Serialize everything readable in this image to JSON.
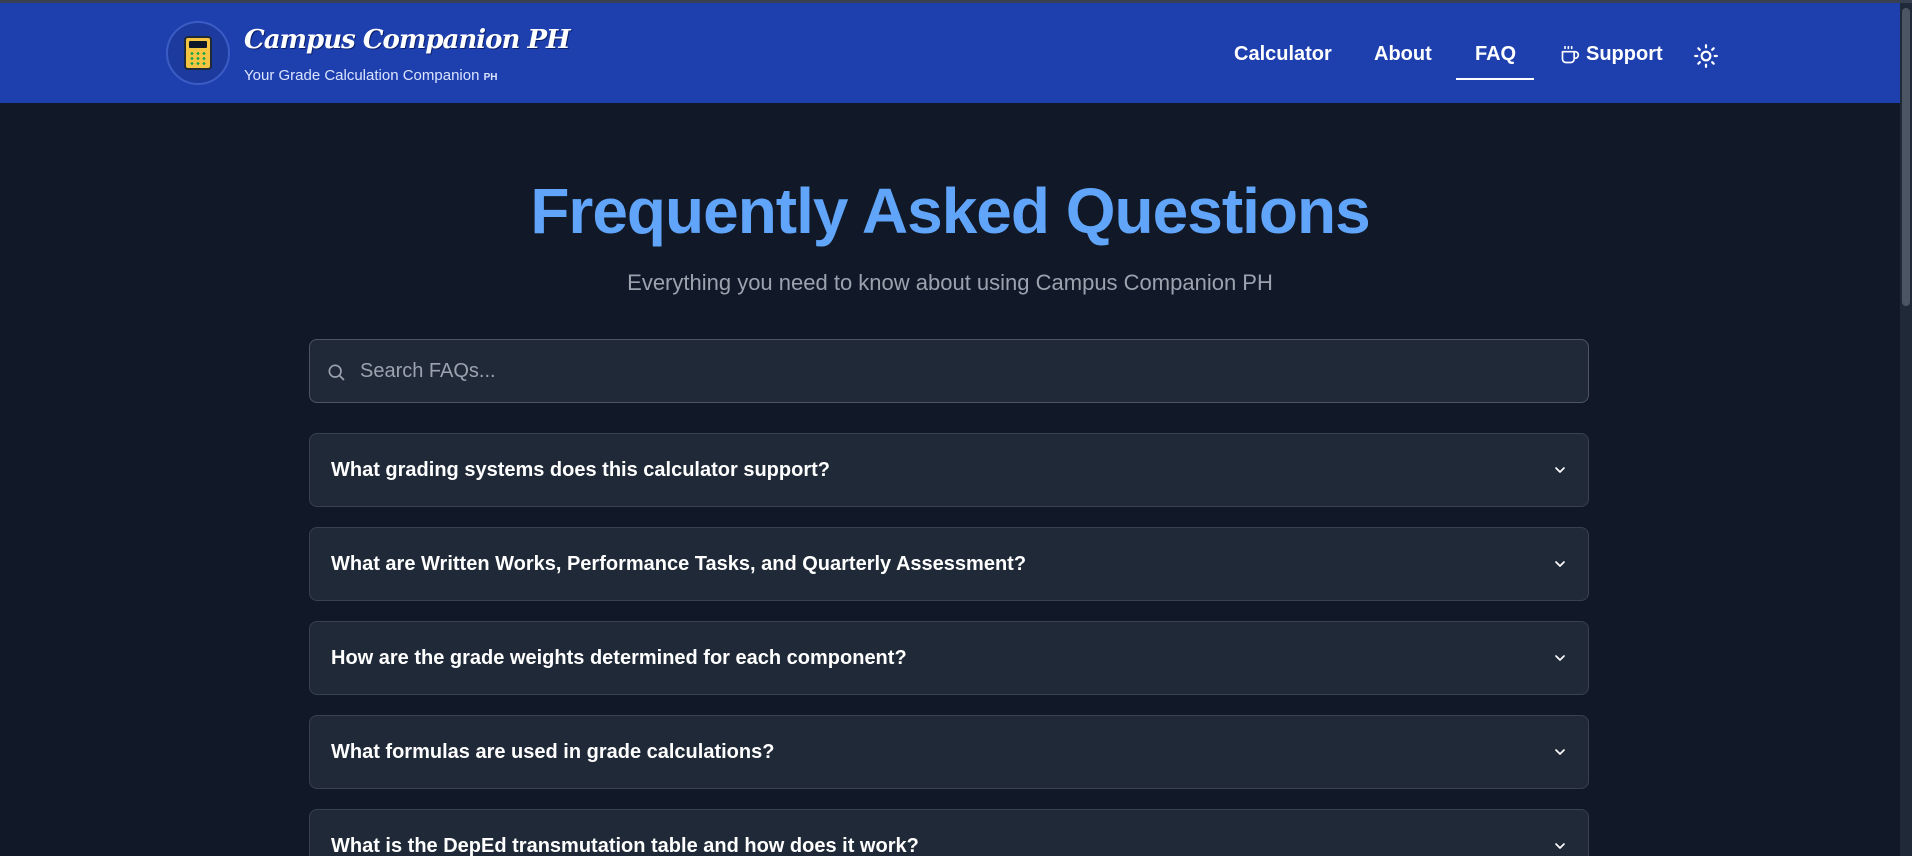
{
  "brand": {
    "title": "Campus Companion PH",
    "subtitle": "Your Grade Calculation Companion",
    "subtitle_suffix": "PH",
    "logo_icon": "calculator-icon"
  },
  "nav": {
    "calculator": "Calculator",
    "about": "About",
    "faq": "FAQ",
    "support": "Support",
    "active": "FAQ",
    "support_icon": "coffee-cup-icon",
    "theme_icon": "sun-icon"
  },
  "page": {
    "title": "Frequently Asked Questions",
    "subtitle": "Everything you need to know about using Campus Companion PH"
  },
  "search": {
    "placeholder": "Search FAQs...",
    "value": ""
  },
  "faqs": [
    {
      "question": "What grading systems does this calculator support?"
    },
    {
      "question": "What are Written Works, Performance Tasks, and Quarterly Assessment?"
    },
    {
      "question": "How are the grade weights determined for each component?"
    },
    {
      "question": "What formulas are used in grade calculations?"
    },
    {
      "question": "What is the DepEd transmutation table and how does it work?"
    }
  ],
  "colors": {
    "navbar": "#1e40af",
    "background": "#111827",
    "card": "#1f2937",
    "title_accent": "#60a5fa"
  }
}
